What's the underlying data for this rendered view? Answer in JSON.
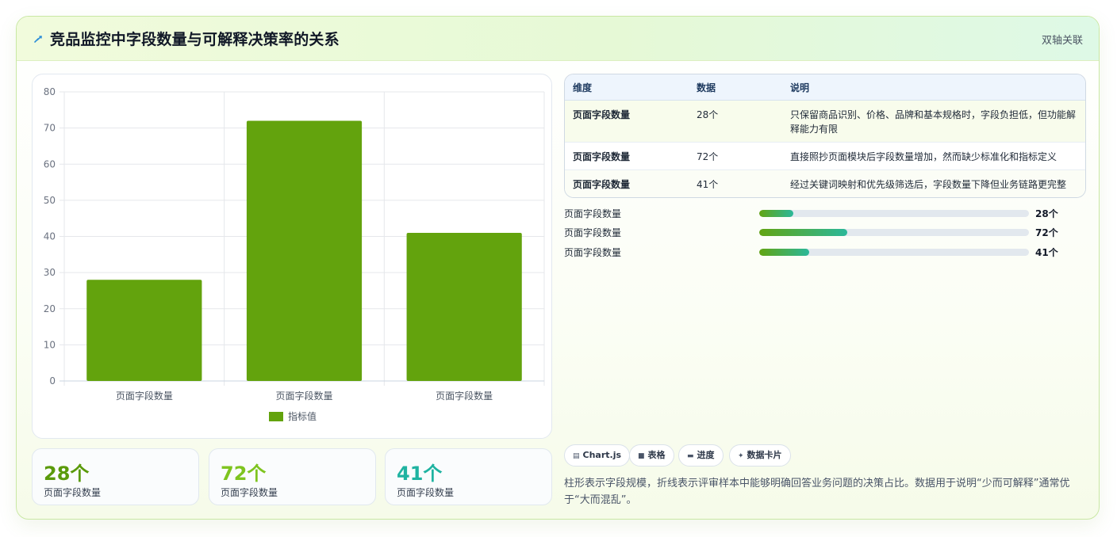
{
  "header": {
    "title": "竞品监控中字段数量与可解释决策率的关系",
    "right_label": "双轴关联"
  },
  "chart_data": {
    "type": "bar",
    "categories": [
      "页面字段数量",
      "页面字段数量",
      "页面字段数量"
    ],
    "series": [
      {
        "name": "指标值",
        "values": [
          28,
          72,
          41
        ]
      }
    ],
    "ylim": [
      0,
      80
    ],
    "yticks": [
      0,
      10,
      20,
      30,
      40,
      50,
      60,
      70,
      80
    ],
    "grid": true,
    "legend_position": "bottom",
    "colors": {
      "bar": "#63a30d"
    }
  },
  "kpis": [
    {
      "value": "28个",
      "label": "页面字段数量",
      "color": "#5a9a0a"
    },
    {
      "value": "72个",
      "label": "页面字段数量",
      "color": "#7ec41f"
    },
    {
      "value": "41个",
      "label": "页面字段数量",
      "color": "#1fb3a1"
    }
  ],
  "table": {
    "headers": [
      "维度",
      "数据",
      "说明"
    ],
    "rows": [
      [
        "页面字段数量",
        "28个",
        "只保留商品识别、价格、品牌和基本规格时，字段负担低，但功能解释能力有限"
      ],
      [
        "页面字段数量",
        "72个",
        "直接照抄页面模块后字段数量增加，然而缺少标准化和指标定义"
      ],
      [
        "页面字段数量",
        "41个",
        "经过关键词映射和优先级筛选后，字段数量下降但业务链路更完整"
      ]
    ]
  },
  "progress": [
    {
      "label": "页面字段数量",
      "value": "28个",
      "fraction": 0.125
    },
    {
      "label": "页面字段数量",
      "value": "72个",
      "fraction": 0.325
    },
    {
      "label": "页面字段数量",
      "value": "41个",
      "fraction": 0.185
    }
  ],
  "tags": [
    {
      "icon": "chart-icon",
      "label": "Chart.js"
    },
    {
      "icon": "table-icon",
      "label": "表格"
    },
    {
      "icon": "progress-icon",
      "label": "进度"
    },
    {
      "icon": "sparkle-icon",
      "label": "数据卡片"
    }
  ],
  "description": "柱形表示字段规模，折线表示评审样本中能够明确回答业务问题的决策占比。数据用于说明“少而可解释”通常优于“大而混乱”。"
}
